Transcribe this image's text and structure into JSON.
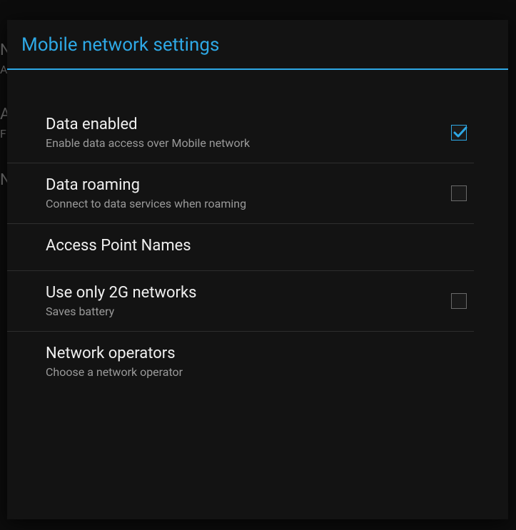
{
  "backdrop": {
    "line1": "N",
    "line2": "A",
    "line3": "A",
    "line4": "F",
    "line5": "N"
  },
  "dialog": {
    "title": "Mobile network settings"
  },
  "items": [
    {
      "title": "Data enabled",
      "subtitle": "Enable data access over Mobile network",
      "checked": true,
      "has_checkbox": true
    },
    {
      "title": "Data roaming",
      "subtitle": "Connect to data services when roaming",
      "checked": false,
      "has_checkbox": true
    },
    {
      "title": "Access Point Names",
      "subtitle": "",
      "has_checkbox": false
    },
    {
      "title": "Use only 2G networks",
      "subtitle": "Saves battery",
      "checked": false,
      "has_checkbox": true
    },
    {
      "title": "Network operators",
      "subtitle": "Choose a network operator",
      "has_checkbox": false
    }
  ]
}
